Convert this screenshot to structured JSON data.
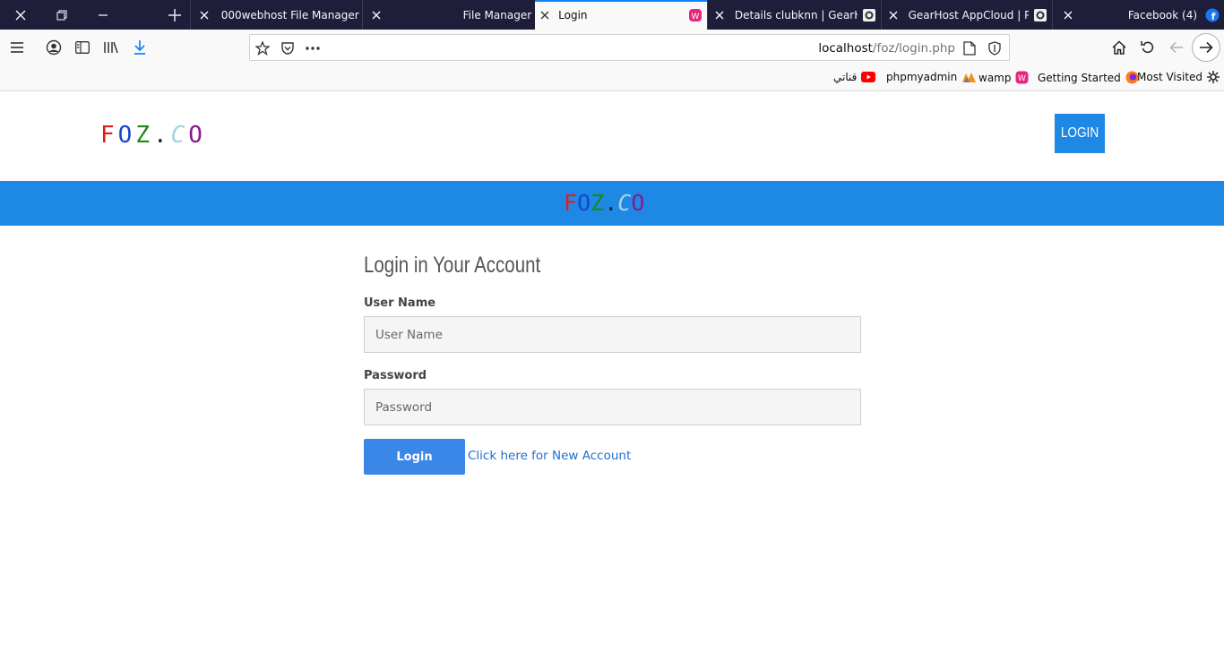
{
  "browser": {
    "tabs": [
      {
        "title": "000webhost File Manager",
        "active": false
      },
      {
        "title": "File Manager",
        "active": false
      },
      {
        "title": "Login",
        "active": true
      },
      {
        "title": "Details clubknn | GearHo",
        "active": false
      },
      {
        "title": "GearHost AppCloud | Pu",
        "active": false
      },
      {
        "title": "Facebook (4)",
        "active": false
      }
    ],
    "address": {
      "host": "localhost",
      "path": "/foz/login.php"
    },
    "accent_color": "#0a84ff"
  },
  "bookmarks": [
    {
      "label": "Most Visited",
      "icon": "gear-icon"
    },
    {
      "label": "Getting Started",
      "icon": "firefox-icon"
    },
    {
      "label": "wamp",
      "icon": "wamp-icon"
    },
    {
      "label": "phpmyadmin",
      "icon": "phpmyadmin-icon"
    },
    {
      "label": "قناتي",
      "icon": "youtube-icon"
    }
  ],
  "site": {
    "logo_letters": [
      {
        "ch": "F",
        "color": "#e41b1b"
      },
      {
        "ch": "O",
        "color": "#1a44d0"
      },
      {
        "ch": "Z",
        "color": "#178a17"
      },
      {
        "ch": ".",
        "color": "#222222"
      },
      {
        "ch": "C",
        "color": "#a8d2e0"
      },
      {
        "ch": "O",
        "color": "#8a1a8a"
      }
    ],
    "banner_logo_letters": [
      {
        "ch": "F",
        "color": "#e41b1b"
      },
      {
        "ch": "O",
        "color": "#1a44d0"
      },
      {
        "ch": "Z",
        "color": "#178a17"
      },
      {
        "ch": ".",
        "color": "#222222"
      },
      {
        "ch": "C",
        "color": "#a8d2e0"
      },
      {
        "ch": "O",
        "color": "#8a1a8a"
      }
    ],
    "header_login_label": "LOGIN",
    "brand_color": "#1e88e5"
  },
  "form": {
    "title": "Login in Your Account",
    "username_label": "User Name",
    "username_placeholder": "User Name",
    "password_label": "Password",
    "password_placeholder": "Password",
    "submit_label": "Login",
    "new_account_link": "Click here for New Account"
  }
}
